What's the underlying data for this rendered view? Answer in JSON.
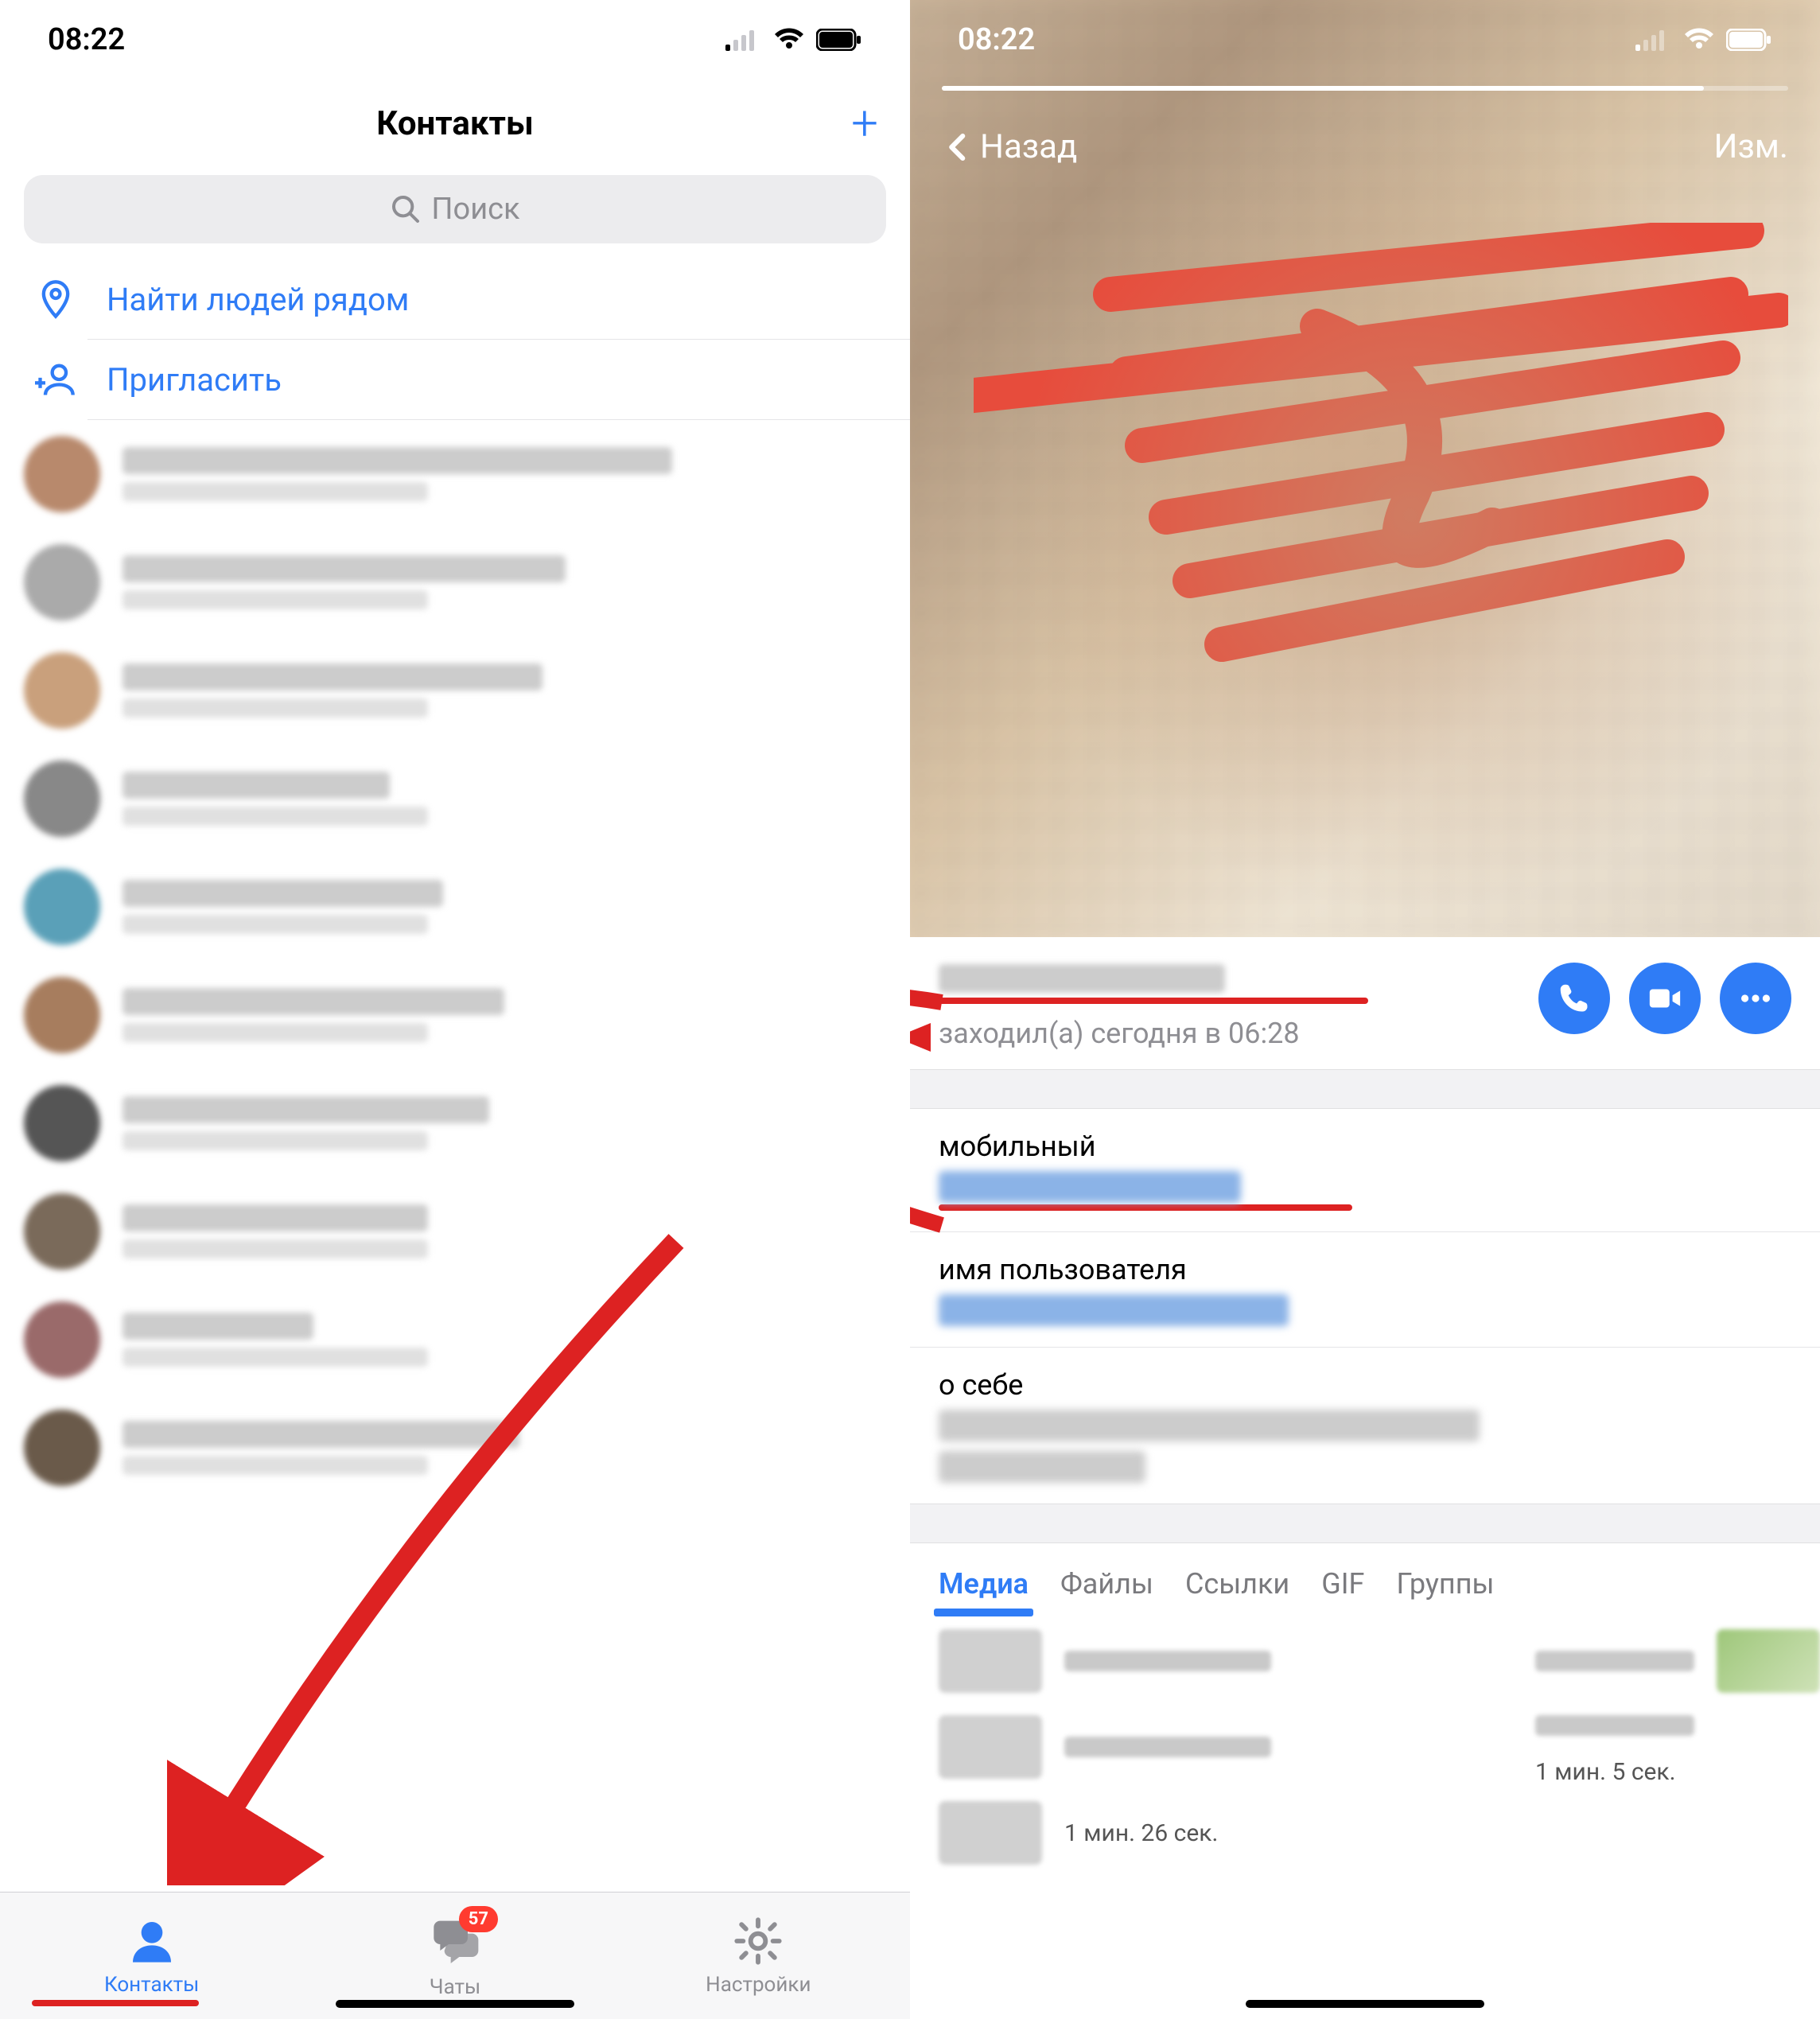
{
  "left": {
    "status_time": "08:22",
    "header_title": "Контакты",
    "search_placeholder": "Поиск",
    "find_nearby": "Найти людей рядом",
    "invite": "Пригласить",
    "tabs": {
      "contacts": "Контакты",
      "chats": "Чаты",
      "chats_badge": "57",
      "settings": "Настройки"
    }
  },
  "right": {
    "status_time": "08:22",
    "back": "Назад",
    "edit": "Изм.",
    "last_seen": "заходил(а) сегодня в 06:28",
    "mobile_label": "мобильный",
    "username_label": "имя пользователя",
    "about_label": "о себе",
    "media_tabs": {
      "media": "Медиа",
      "files": "Файлы",
      "links": "Ссылки",
      "gif": "GIF",
      "groups": "Группы"
    },
    "media_rows": [
      "1 мин. 26 сек.",
      "1 мин. 5 сек."
    ]
  }
}
